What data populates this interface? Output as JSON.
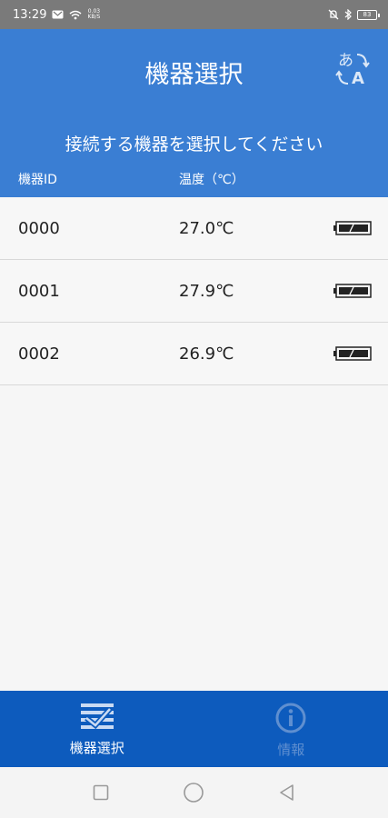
{
  "status_bar": {
    "time": "13:29",
    "net_speed_top": "0.03",
    "net_speed_bottom": "KB/S",
    "battery": "83"
  },
  "header": {
    "title": "機器選択",
    "subtitle": "接続する機器を選択してください",
    "column_id": "機器ID",
    "column_temp": "温度（℃）",
    "translate_icon": "translate-icon"
  },
  "devices": [
    {
      "id": "0000",
      "temperature": "27.0℃",
      "battery_icon": "battery-icon"
    },
    {
      "id": "0001",
      "temperature": "27.9℃",
      "battery_icon": "battery-icon"
    },
    {
      "id": "0002",
      "temperature": "26.9℃",
      "battery_icon": "battery-icon"
    }
  ],
  "tabs": [
    {
      "label": "機器選択",
      "icon": "device-select-icon",
      "active": true
    },
    {
      "label": "情報",
      "icon": "info-icon",
      "active": false
    }
  ],
  "colors": {
    "header": "#3a7ed3",
    "tabbar": "#0d5bbd",
    "status_bar": "#7a7a7a"
  }
}
